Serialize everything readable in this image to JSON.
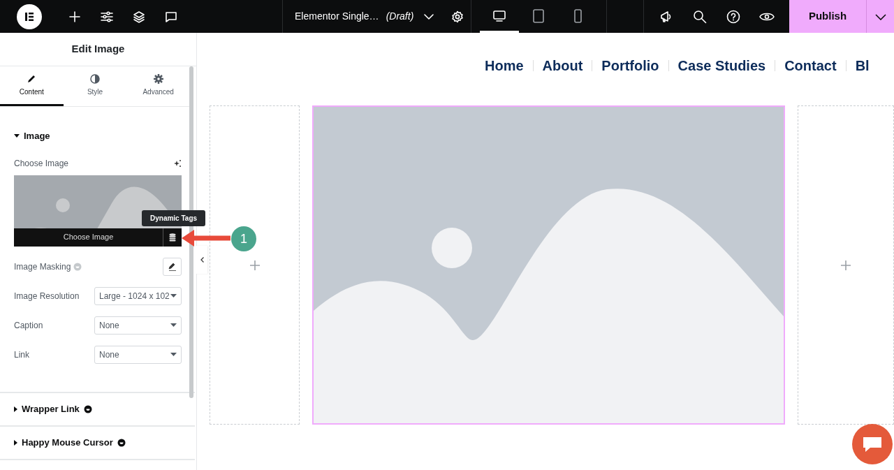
{
  "topbar": {
    "document_title": "Elementor Single…",
    "status": "(Draft)",
    "devices": [
      {
        "kind": "desktop",
        "selected": true
      },
      {
        "kind": "tablet",
        "selected": false
      },
      {
        "kind": "mobile",
        "selected": false
      }
    ],
    "publish": "Publish"
  },
  "panel": {
    "title": "Edit Image",
    "tabs": [
      {
        "label": "Content",
        "selected": true
      },
      {
        "label": "Style",
        "selected": false
      },
      {
        "label": "Advanced",
        "selected": false
      }
    ],
    "section": {
      "title": "Image",
      "expanded": true
    },
    "choose_image_label": "Choose Image",
    "choose_image_button": "Choose Image",
    "tooltip": "Dynamic Tags",
    "fields": [
      {
        "kind": "button",
        "label": "Image Masking",
        "pro": true
      },
      {
        "kind": "select",
        "label": "Image Resolution",
        "value": "Large - 1024 x 102"
      },
      {
        "kind": "select",
        "label": "Caption",
        "value": "None"
      },
      {
        "kind": "select",
        "label": "Link",
        "value": "None"
      }
    ],
    "collapsed_sections": [
      {
        "title": "Wrapper Link",
        "expanded": false,
        "pro": true
      },
      {
        "title": "Happy Mouse Cursor",
        "expanded": false,
        "pro": true
      }
    ]
  },
  "annotation": {
    "number": "1"
  },
  "canvas": {
    "nav": [
      "Home",
      "About",
      "Portfolio",
      "Case Studies",
      "Contact",
      "Bl"
    ]
  }
}
